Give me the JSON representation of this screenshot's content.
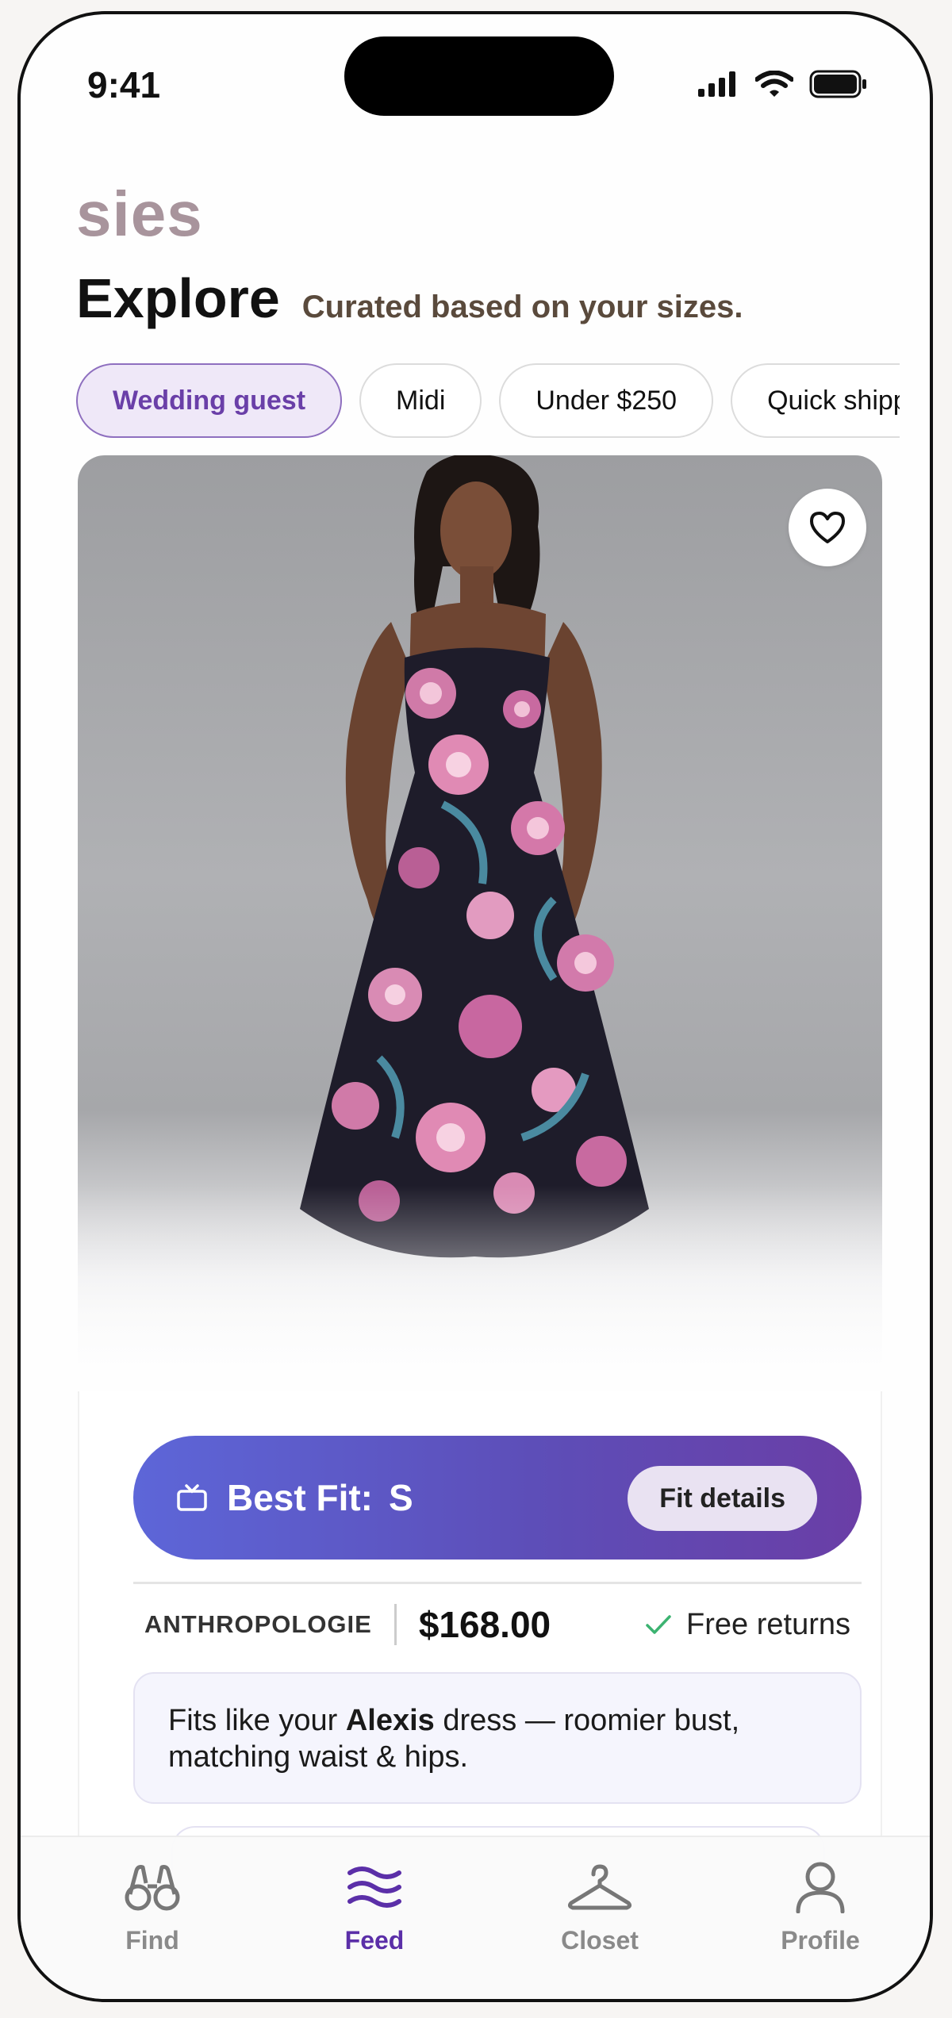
{
  "status_bar": {
    "time": "9:41"
  },
  "app": {
    "brand": "sies"
  },
  "header": {
    "title": "Explore",
    "subtitle": "Curated based on your sizes."
  },
  "filters": [
    {
      "label": "Wedding guest",
      "active": true
    },
    {
      "label": "Midi",
      "active": false
    },
    {
      "label": "Under $250",
      "active": false
    },
    {
      "label": "Quick shipping",
      "active": false
    }
  ],
  "product": {
    "retailer": "ANTHROPOLOGIE",
    "price": "$168.00",
    "returns": "Free returns",
    "best_fit_label": "Best Fit:",
    "best_fit_size": "S",
    "fit_details_label": "Fit details",
    "fit_note_prefix": "Fits like your ",
    "fit_note_ref": "Alexis",
    "fit_note_suffix": " dress — roomier bust, matching waist & hips."
  },
  "tabs": [
    {
      "label": "Find",
      "icon": "binoculars-icon",
      "active": false
    },
    {
      "label": "Feed",
      "icon": "waves-icon",
      "active": true
    },
    {
      "label": "Closet",
      "icon": "hanger-icon",
      "active": false
    },
    {
      "label": "Profile",
      "icon": "person-icon",
      "active": false
    }
  ],
  "colors": {
    "accent": "#5b2fa8",
    "fit_gradient_start": "#5d66d8",
    "fit_gradient_end": "#6a3ea6",
    "check": "#3cb371"
  }
}
